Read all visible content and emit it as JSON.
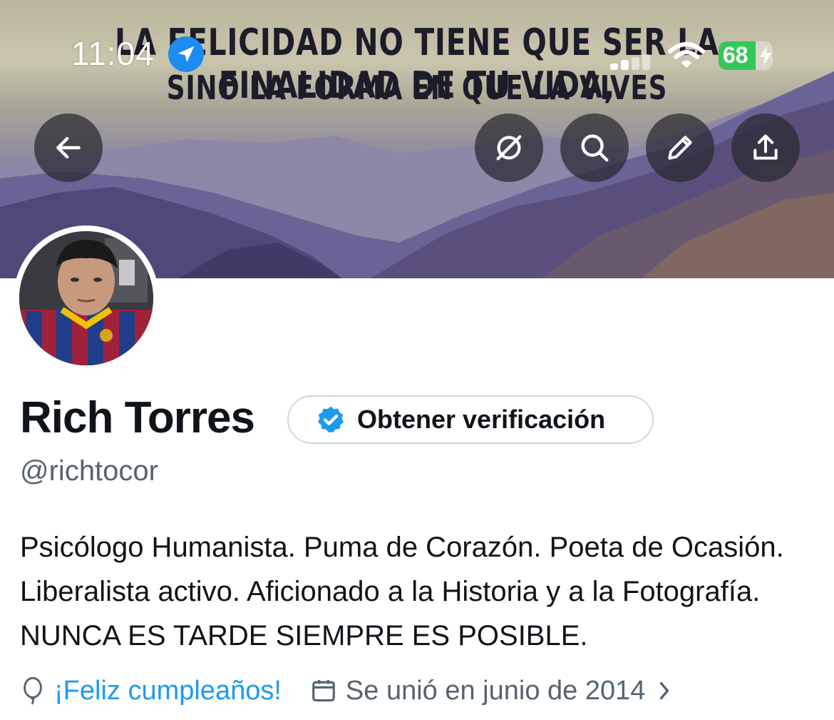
{
  "status_bar": {
    "time": "11:04",
    "battery": "68",
    "battery_level": 0.68,
    "icons": [
      "location-arrow-icon",
      "cellular-signal-icon",
      "wifi-icon",
      "battery-charging-icon"
    ]
  },
  "banner": {
    "quote_line1": "LA FELICIDAD NO TIENE QUE SER LA FINALIDAD DE TU VIDA,",
    "quote_line2": "SINO LA FORMA EN QUE LA VIVES"
  },
  "nav": {
    "back_icon": "arrow-left-icon",
    "actions": [
      "grok-icon",
      "search-icon",
      "pencil-icon",
      "share-icon"
    ]
  },
  "profile": {
    "name": "Rich Torres",
    "verify_label": "Obtener verificación",
    "handle": "@richtocor",
    "bio": "Psicólogo Humanista. Puma de Corazón. Poeta de Ocasión. Liberalista activo. Aficionado a la Historia y a la Fotografía. NUNCA ES TARDE SIEMPRE ES POSIBLE.",
    "birthday": "¡Feliz cumpleaños!",
    "joined": "Se unió en junio de 2014"
  },
  "colors": {
    "accent": "#1d9bf0",
    "secondary_text": "#536471",
    "battery_green": "#34c759"
  }
}
